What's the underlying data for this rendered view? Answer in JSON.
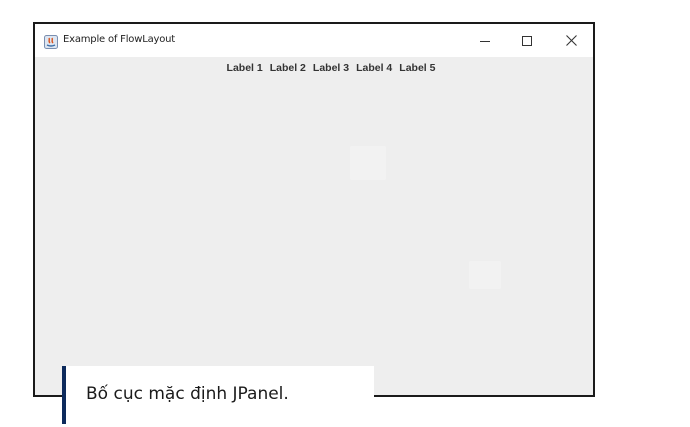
{
  "window": {
    "title": "Example of FlowLayout",
    "controls": {
      "minimize_icon": "minimize-icon",
      "maximize_icon": "maximize-icon",
      "close_icon": "close-icon"
    }
  },
  "panel": {
    "labels": [
      "Label 1",
      "Label 2",
      "Label 3",
      "Label 4",
      "Label 5"
    ]
  },
  "caption": {
    "text": "Bố cục mặc định JPanel.",
    "accent_color": "#0d2a5c"
  }
}
